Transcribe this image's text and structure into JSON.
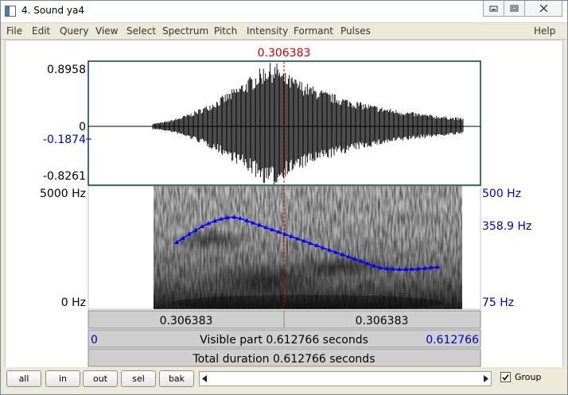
{
  "window": {
    "title": "4. Sound ya4"
  },
  "menu": {
    "items": [
      "File",
      "Edit",
      "Query",
      "View",
      "Select",
      "Spectrum",
      "Pitch",
      "Intensity",
      "Formant",
      "Pulses"
    ],
    "help": "Help"
  },
  "cursor": {
    "time": "0.306383",
    "left_time": "0.306383",
    "right_time": "0.306383"
  },
  "waveform": {
    "max": "0.8958",
    "zero": "0",
    "cursor_value": "-0.1874",
    "min": "-0.8261"
  },
  "spectrogram": {
    "freq_top": "5000 Hz",
    "freq_bottom": "0 Hz",
    "pitch_top": "500 Hz",
    "pitch_cursor": "358.9 Hz",
    "pitch_bottom": "75 Hz"
  },
  "visible": {
    "start": "0",
    "label": "Visible part 0.612766 seconds",
    "end": "0.612766"
  },
  "total": {
    "label": "Total duration 0.612766 seconds"
  },
  "buttons": {
    "all": "all",
    "in": "in",
    "out": "out",
    "sel": "sel",
    "bak": "bak"
  },
  "group": {
    "label": "Group",
    "checked": true
  },
  "colors": {
    "cursor": "#cc0000",
    "pitch": "#0000ff",
    "axis_blue": "#0000c0",
    "frame": "#004040"
  },
  "icons": {
    "minimize": "minimize-icon",
    "maximize": "maximize-icon",
    "close": "close-icon",
    "scroll_left": "arrow-left-icon",
    "scroll_right": "arrow-right-icon",
    "check": "checkmark-icon"
  }
}
